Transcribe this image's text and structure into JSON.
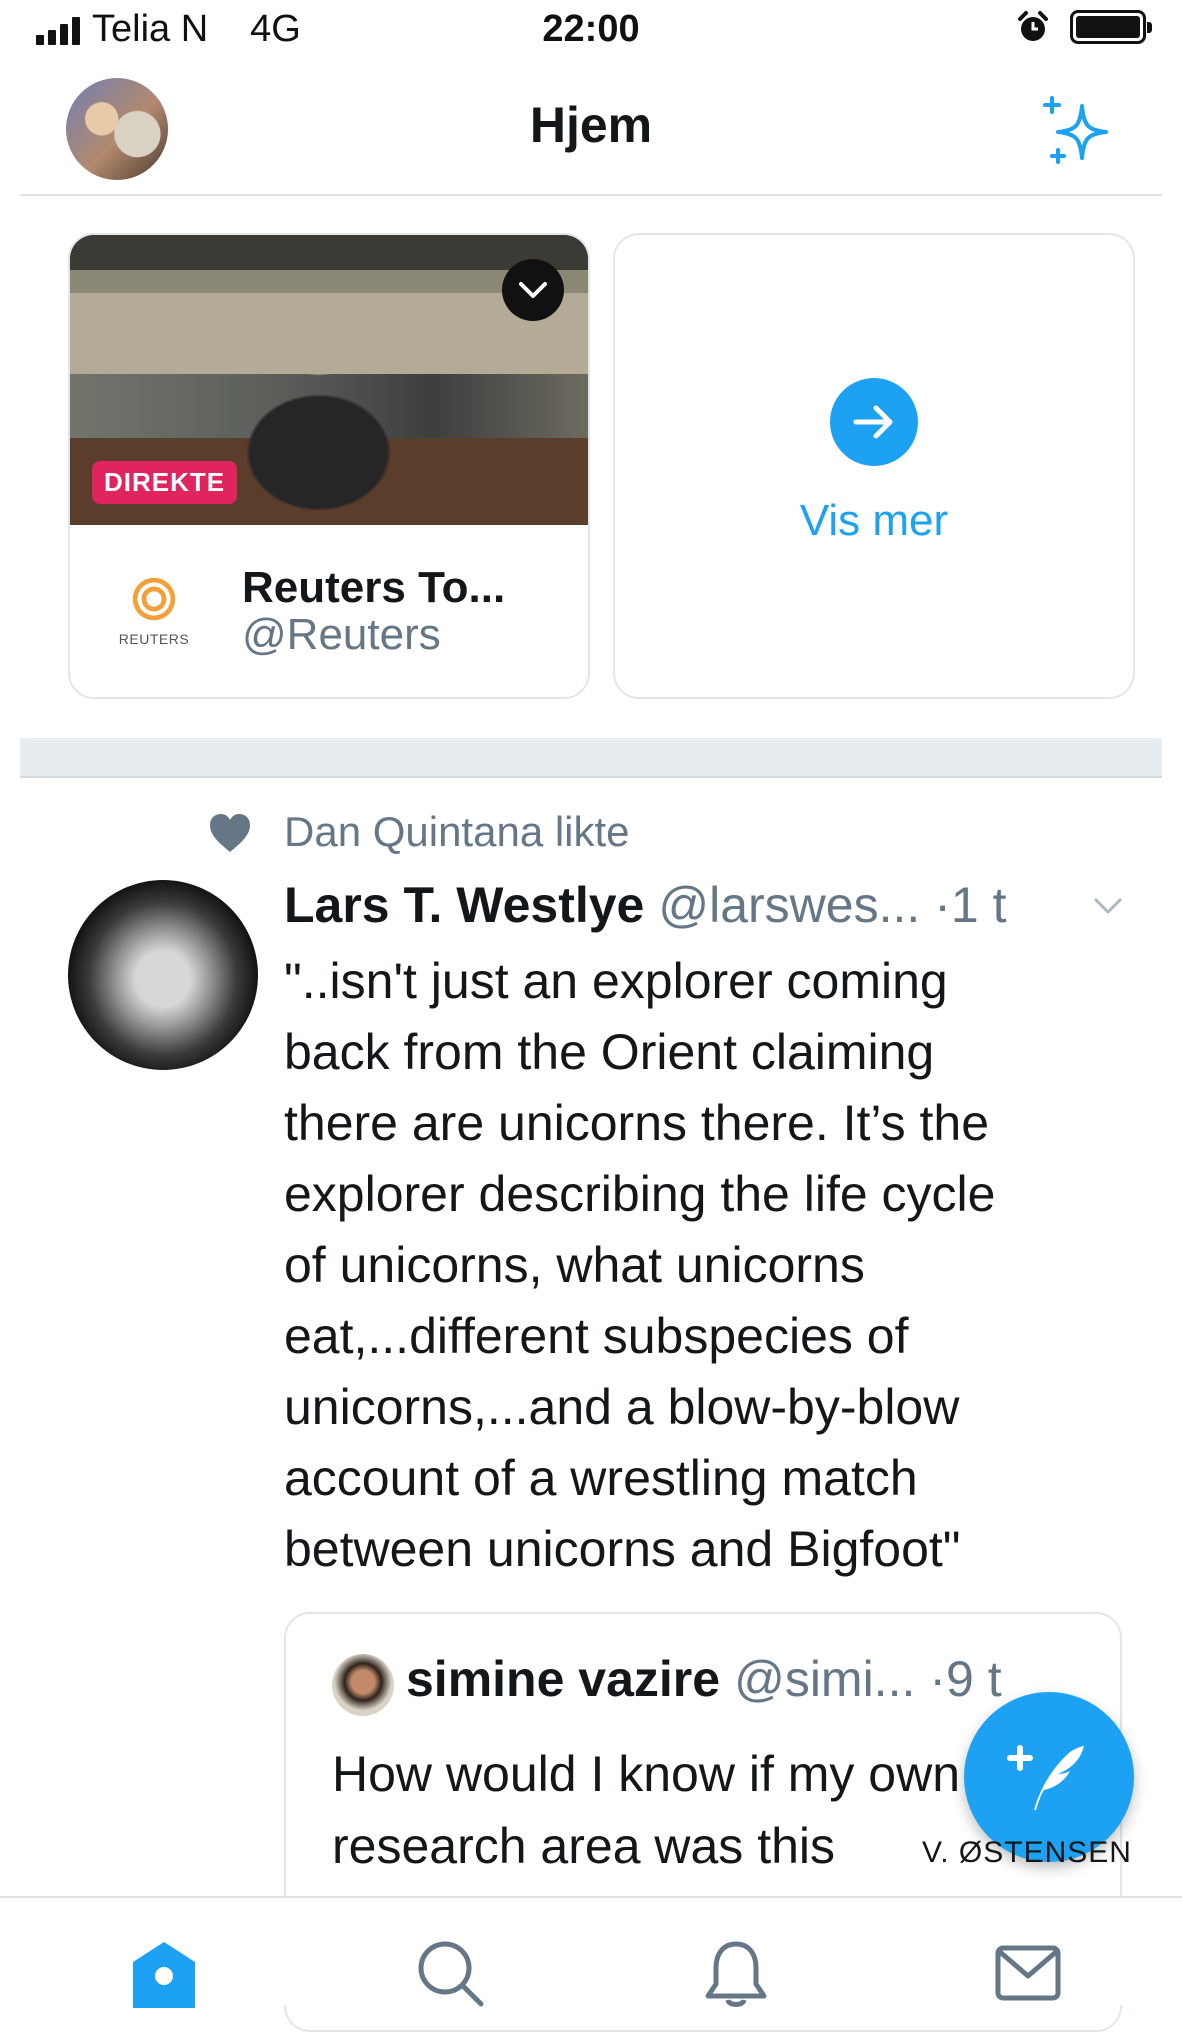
{
  "status_bar": {
    "carrier": "Telia N",
    "network": "4G",
    "time": "22:00",
    "alarm_icon": "alarm-clock-icon",
    "battery_icon": "battery-full-icon"
  },
  "header": {
    "title": "Hjem",
    "avatar_icon": "profile-avatar",
    "sparkle_icon": "sparkle-icon",
    "accent_color": "#1da1f2"
  },
  "live_carousel": {
    "live_card": {
      "badge": "DIREKTE",
      "badge_color": "#e0245e",
      "source_logo_text": "REUTERS",
      "source_name": "Reuters To...",
      "source_handle": "@Reuters"
    },
    "more_card": {
      "label": "Vis mer",
      "icon": "arrow-right-icon"
    }
  },
  "tweet": {
    "social_context": "Dan Quintana likte",
    "author_name": "Lars T. Westlye",
    "author_handle": "@larswes...",
    "time": "·1 t",
    "text": "\"..isn't just an explorer coming\nback from the Orient claiming\nthere are unicorns there. It’s the\nexplorer describing the life cycle\nof unicorns, what unicorns\neat,...different subspecies of\nunicorns,...and a blow-by-blow\naccount of a wrestling match\nbetween unicorns and Bigfoot\"",
    "quoted": {
      "author_name": "simine vazire",
      "author_handle": "@simi...",
      "time": "·9 t",
      "text": "How would I know if my own\nresearch area was this"
    }
  },
  "fab": {
    "icon": "compose-tweet-icon"
  },
  "watermark": "V. ØSTENSEN",
  "bottom_nav": [
    {
      "name": "home",
      "icon": "home-icon",
      "active": true
    },
    {
      "name": "search",
      "icon": "search-icon",
      "active": false
    },
    {
      "name": "notifications",
      "icon": "bell-icon",
      "active": false
    },
    {
      "name": "messages",
      "icon": "mail-icon",
      "active": false
    }
  ]
}
